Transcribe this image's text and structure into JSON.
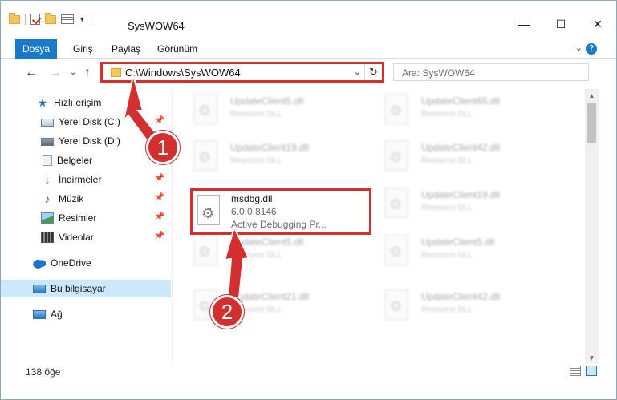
{
  "window": {
    "title": "SysWOW64",
    "controls": {
      "minimize": "—",
      "maximize": "☐",
      "close": "✕"
    }
  },
  "ribbon": {
    "tabs": [
      "Dosya",
      "Giriş",
      "Paylaş",
      "Görünüm"
    ],
    "help": "?"
  },
  "address_bar": {
    "path": "C:\\Windows\\SysWOW64",
    "search_placeholder": "Ara: SysWOW64"
  },
  "nav_pane": {
    "items": [
      {
        "label": "Hızlı erişim",
        "icon": "star-icon"
      },
      {
        "label": "Yerel Disk (C:)",
        "icon": "drive-icon",
        "pinned": true
      },
      {
        "label": "Yerel Disk (D:)",
        "icon": "drive-icon"
      },
      {
        "label": "Belgeler",
        "icon": "documents-icon",
        "pinned": true
      },
      {
        "label": "İndirmeler",
        "icon": "downloads-icon",
        "pinned": true
      },
      {
        "label": "Müzik",
        "icon": "music-icon",
        "pinned": true
      },
      {
        "label": "Resimler",
        "icon": "pictures-icon",
        "pinned": true
      },
      {
        "label": "Videolar",
        "icon": "videos-icon",
        "pinned": true
      },
      {
        "label": "OneDrive",
        "icon": "cloud-icon"
      },
      {
        "label": "Bu bilgisayar",
        "icon": "computer-icon",
        "selected": true
      },
      {
        "label": "Ağ",
        "icon": "network-icon"
      }
    ]
  },
  "files": {
    "blurred": [
      {
        "name": "UpdateClient5.dll",
        "desc": "Resource DLL"
      },
      {
        "name": "UpdateClient65.dll",
        "desc": "Resource DLL"
      },
      {
        "name": "UpdateClient19.dll",
        "desc": "Resource DLL"
      },
      {
        "name": "UpdateClient42.dll",
        "desc": "Resource DLL"
      },
      {
        "name": "UpdateClient19.dll",
        "desc": "Resource DLL"
      },
      {
        "name": "UpdateClient5.dll",
        "desc": "Resource DLL"
      },
      {
        "name": "UpdateClient5.dll",
        "desc": "Resource DLL"
      },
      {
        "name": "UpdateClient21.dll",
        "desc": "Resource DLL"
      },
      {
        "name": "UpdateClient42.dll",
        "desc": "Resource DLL"
      }
    ],
    "focused": {
      "name": "msdbg.dll",
      "version": "6.0.0.8146",
      "desc": "Active Debugging Pr..."
    }
  },
  "annotations": {
    "step1": "1",
    "step2": "2",
    "color": "#d32f2f"
  },
  "status": {
    "item_count": "138 öğe"
  }
}
